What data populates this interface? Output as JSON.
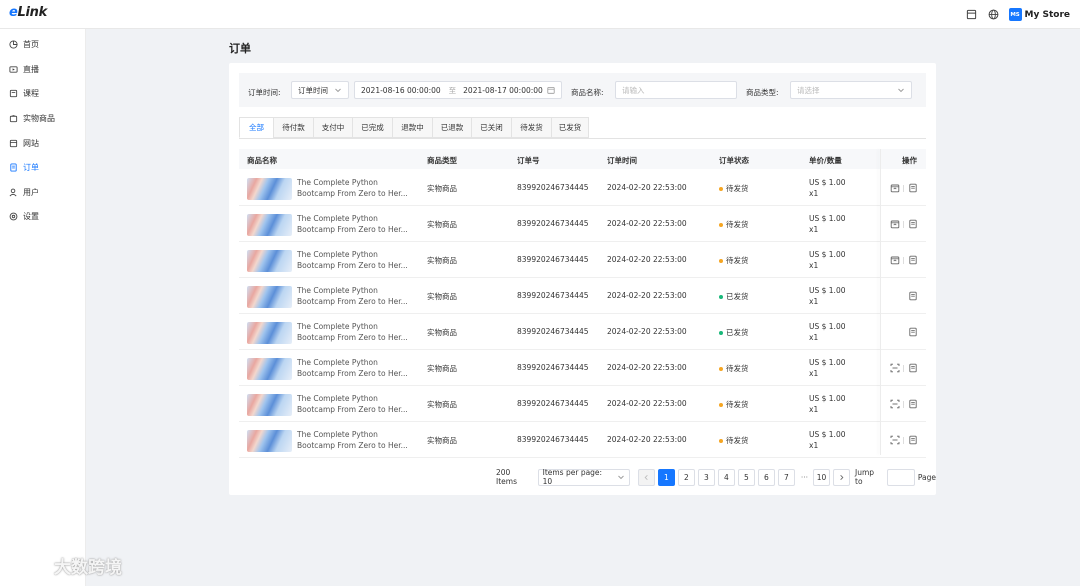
{
  "app": {
    "logo_e": "e",
    "logo_rest": "Link",
    "store_badge": "MS",
    "store_name": "My Store"
  },
  "sidebar": {
    "items": [
      {
        "label": "首页",
        "icon": "home-icon"
      },
      {
        "label": "直播",
        "icon": "live-icon"
      },
      {
        "label": "课程",
        "icon": "course-icon"
      },
      {
        "label": "实物商品",
        "icon": "product-icon"
      },
      {
        "label": "网站",
        "icon": "website-icon"
      },
      {
        "label": "订单",
        "icon": "order-icon",
        "active": true
      },
      {
        "label": "用户",
        "icon": "user-icon"
      },
      {
        "label": "设置",
        "icon": "settings-icon"
      }
    ]
  },
  "watermark": "大数跨境",
  "page": {
    "title": "订单"
  },
  "filters": {
    "time_label": "订单时间:",
    "time_select": "订单时间",
    "date_start": "2021-08-16 00:00:00",
    "date_sep": "至",
    "date_end": "2021-08-17 00:00:00",
    "name_label": "商品名称:",
    "name_placeholder": "请输入",
    "type_label": "商品类型:",
    "type_placeholder": "请选择"
  },
  "tabs": [
    "全部",
    "待付款",
    "支付中",
    "已完成",
    "退款中",
    "已退款",
    "已关闭",
    "待发货",
    "已发货"
  ],
  "table": {
    "headers": {
      "name": "商品名称",
      "type": "商品类型",
      "order_no": "订单号",
      "time": "订单时间",
      "status": "订单状态",
      "price": "单价/数量",
      "ops": "操作"
    },
    "rows": [
      {
        "name1": "The Complete Python",
        "name2": "Bootcamp From Zero to Her...",
        "type": "实物商品",
        "order_no": "839920246734445",
        "time": "2024-02-20 22:53:00",
        "status": "待发货",
        "status_color": "#f5a623",
        "price": "US $ 1.00",
        "qty": "x1",
        "op1": "ship-icon"
      },
      {
        "name1": "The Complete Python",
        "name2": "Bootcamp From Zero to Her...",
        "type": "实物商品",
        "order_no": "839920246734445",
        "time": "2024-02-20 22:53:00",
        "status": "待发货",
        "status_color": "#f5a623",
        "price": "US $ 1.00",
        "qty": "x1",
        "op1": "ship-icon"
      },
      {
        "name1": "The Complete Python",
        "name2": "Bootcamp From Zero to Her...",
        "type": "实物商品",
        "order_no": "839920246734445",
        "time": "2024-02-20 22:53:00",
        "status": "待发货",
        "status_color": "#f5a623",
        "price": "US $ 1.00",
        "qty": "x1",
        "op1": "ship-icon"
      },
      {
        "name1": "The Complete Python",
        "name2": "Bootcamp From Zero to Her...",
        "type": "实物商品",
        "order_no": "839920246734445",
        "time": "2024-02-20 22:53:00",
        "status": "已发货",
        "status_color": "#19b87a",
        "price": "US $ 1.00",
        "qty": "x1",
        "op1": ""
      },
      {
        "name1": "The Complete Python",
        "name2": "Bootcamp From Zero to Her...",
        "type": "实物商品",
        "order_no": "839920246734445",
        "time": "2024-02-20 22:53:00",
        "status": "已发货",
        "status_color": "#19b87a",
        "price": "US $ 1.00",
        "qty": "x1",
        "op1": ""
      },
      {
        "name1": "The Complete Python",
        "name2": "Bootcamp From Zero to Her...",
        "type": "实物商品",
        "order_no": "839920246734445",
        "time": "2024-02-20 22:53:00",
        "status": "待发货",
        "status_color": "#f5a623",
        "price": "US $ 1.00",
        "qty": "x1",
        "op1": "scan-icon"
      },
      {
        "name1": "The Complete Python",
        "name2": "Bootcamp From Zero to Her...",
        "type": "实物商品",
        "order_no": "839920246734445",
        "time": "2024-02-20 22:53:00",
        "status": "待发货",
        "status_color": "#f5a623",
        "price": "US $ 1.00",
        "qty": "x1",
        "op1": "scan-icon"
      },
      {
        "name1": "The Complete Python",
        "name2": "Bootcamp From Zero to Her...",
        "type": "实物商品",
        "order_no": "839920246734445",
        "time": "2024-02-20 22:53:00",
        "status": "待发货",
        "status_color": "#f5a623",
        "price": "US $ 1.00",
        "qty": "x1",
        "op1": "scan-icon"
      }
    ]
  },
  "pagination": {
    "total": "200 Items",
    "per_page": "Items per page: 10",
    "pages": [
      "1",
      "2",
      "3",
      "4",
      "5",
      "6",
      "7"
    ],
    "ellipsis": "···",
    "last": "10",
    "jump_label": "Jump to",
    "page_label": "Page",
    "current": "1"
  },
  "colors": {
    "accent": "#1677ff",
    "pending": "#f5a623",
    "shipped": "#19b87a"
  }
}
